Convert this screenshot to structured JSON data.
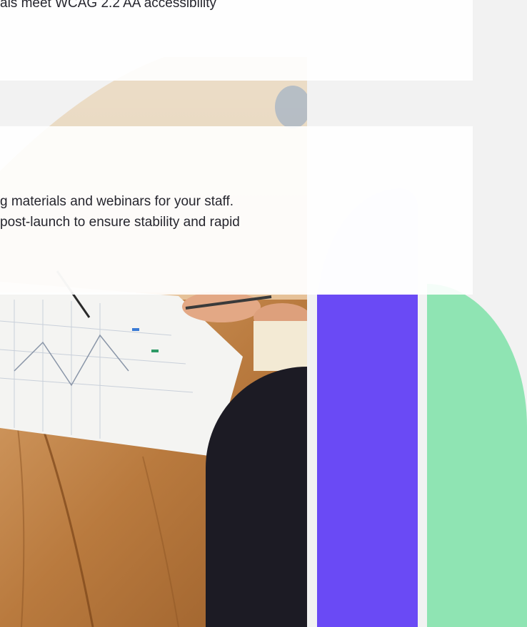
{
  "card_1": {
    "line_1": "als meet WCAG 2.2 AA accessibility"
  },
  "card_2": {
    "line_1": "g materials and webinars for your staff.",
    "line_2": "post-launch to ensure stability and rapid"
  },
  "colors": {
    "dark": "#1c1b24",
    "lavender": "#ebe7ff",
    "purple": "#6a4af5",
    "green": "#8fe4b3",
    "background": "#f2f2f2"
  },
  "images": {
    "photo": "photo of hands sketching charts on paper at a wooden desk"
  }
}
